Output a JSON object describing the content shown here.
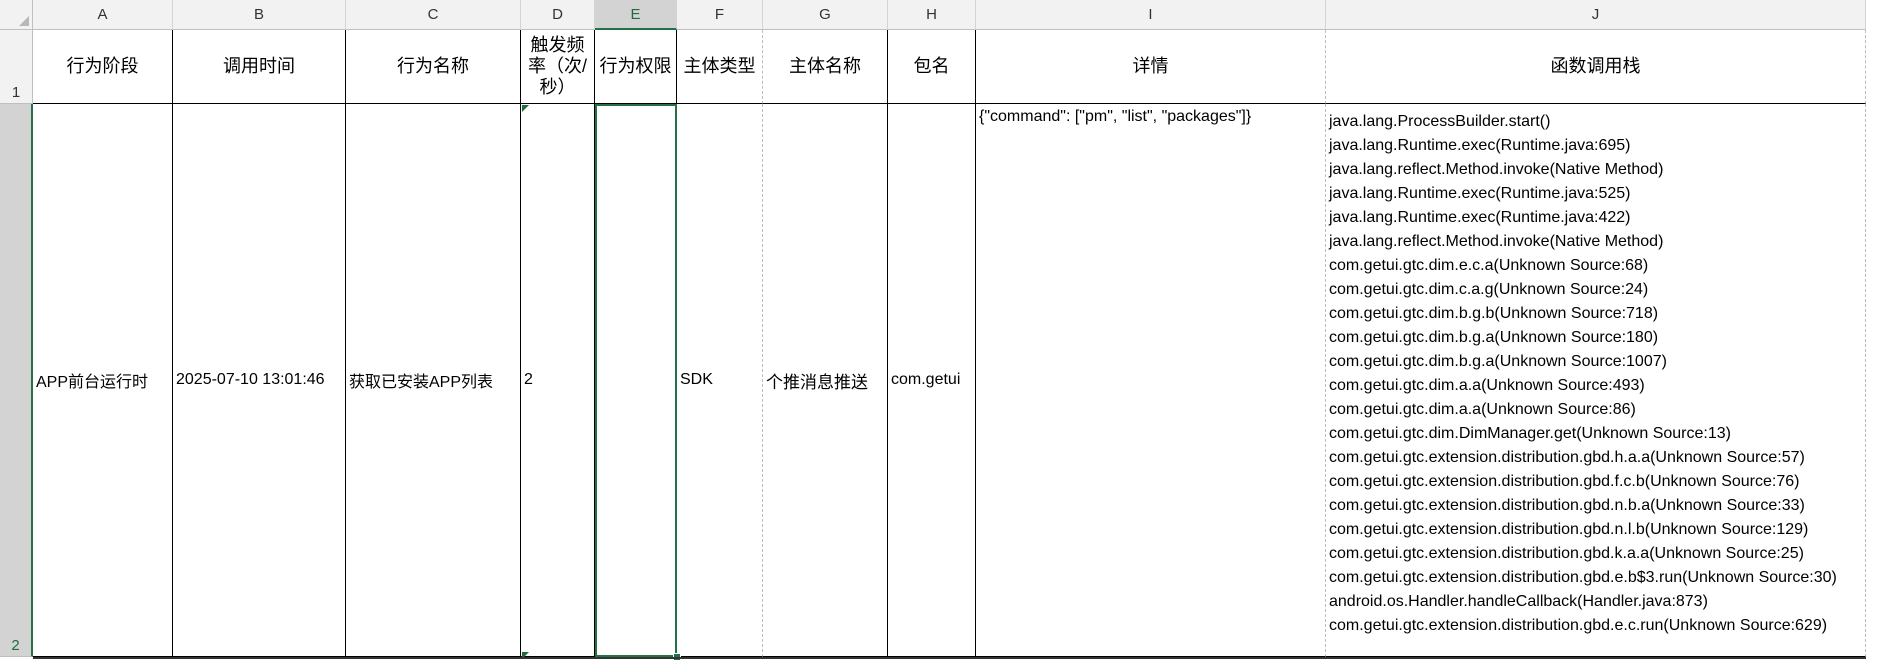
{
  "sheet": {
    "columns": [
      "A",
      "B",
      "C",
      "D",
      "E",
      "F",
      "G",
      "H",
      "I",
      "J"
    ],
    "rows": [
      "1",
      "2"
    ],
    "headers": {
      "stage": "行为阶段",
      "call_time": "调用时间",
      "action_name": "行为名称",
      "frequency": "触发频率（次/秒）",
      "permission": "行为权限",
      "subject_type": "主体类型",
      "subject_name": "主体名称",
      "package": "包名",
      "detail": "详情",
      "call_stack": "函数调用栈"
    },
    "row2": {
      "stage": "APP前台运行时",
      "call_time": "2025-07-10 13:01:46",
      "action_name": "获取已安装APP列表",
      "frequency": "2",
      "permission": "",
      "subject_type": "SDK",
      "subject_name": "个推消息推送",
      "package": "com.getui",
      "detail": "{\"command\": [\"pm\", \"list\", \"packages\"]}",
      "call_stack": "java.lang.ProcessBuilder.start()\njava.lang.Runtime.exec(Runtime.java:695)\njava.lang.reflect.Method.invoke(Native Method)\njava.lang.Runtime.exec(Runtime.java:525)\njava.lang.Runtime.exec(Runtime.java:422)\njava.lang.reflect.Method.invoke(Native Method)\ncom.getui.gtc.dim.e.c.a(Unknown Source:68)\ncom.getui.gtc.dim.c.a.g(Unknown Source:24)\ncom.getui.gtc.dim.b.g.b(Unknown Source:718)\ncom.getui.gtc.dim.b.g.a(Unknown Source:180)\ncom.getui.gtc.dim.b.g.a(Unknown Source:1007)\ncom.getui.gtc.dim.a.a(Unknown Source:493)\ncom.getui.gtc.dim.a.a(Unknown Source:86)\ncom.getui.gtc.dim.DimManager.get(Unknown Source:13)\ncom.getui.gtc.extension.distribution.gbd.h.a.a(Unknown Source:57)\ncom.getui.gtc.extension.distribution.gbd.f.c.b(Unknown Source:76)\ncom.getui.gtc.extension.distribution.gbd.n.b.a(Unknown Source:33)\ncom.getui.gtc.extension.distribution.gbd.n.l.b(Unknown Source:129)\ncom.getui.gtc.extension.distribution.gbd.k.a.a(Unknown Source:25)\ncom.getui.gtc.extension.distribution.gbd.e.b$3.run(Unknown Source:30)\nandroid.os.Handler.handleCallback(Handler.java:873)\ncom.getui.gtc.extension.distribution.gbd.e.c.run(Unknown Source:629)"
    },
    "colors": {
      "selection": "#217346",
      "header_bg": "#f2f2f2"
    }
  }
}
